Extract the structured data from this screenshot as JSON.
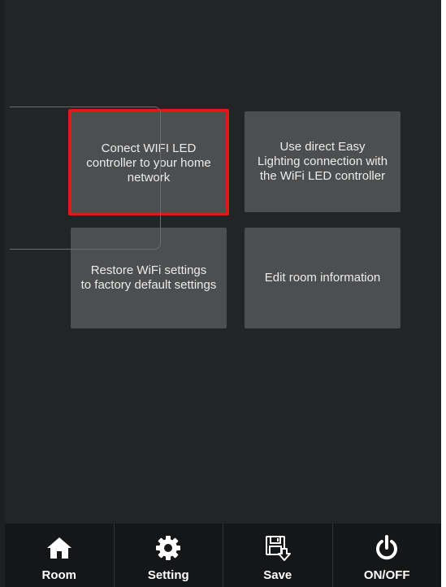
{
  "tiles": {
    "connect": "Conect WIFI LED\ncontroller to your home\nnetwork",
    "direct": "Use direct Easy\nLighting connection with\nthe WiFi LED controller",
    "restore": "Restore WiFi settings\nto factory default settings",
    "edit": "Edit room information"
  },
  "toolbar": {
    "room": {
      "label": "Room",
      "icon": "home-icon"
    },
    "setting": {
      "label": "Setting",
      "icon": "gear-icon"
    },
    "save": {
      "label": "Save",
      "icon": "save-icon"
    },
    "power": {
      "label": "ON/OFF",
      "icon": "power-icon"
    }
  },
  "colors": {
    "background": "#222426",
    "tile": "#4c4e50",
    "selection": "#e01818",
    "toolbar": "#151617"
  }
}
